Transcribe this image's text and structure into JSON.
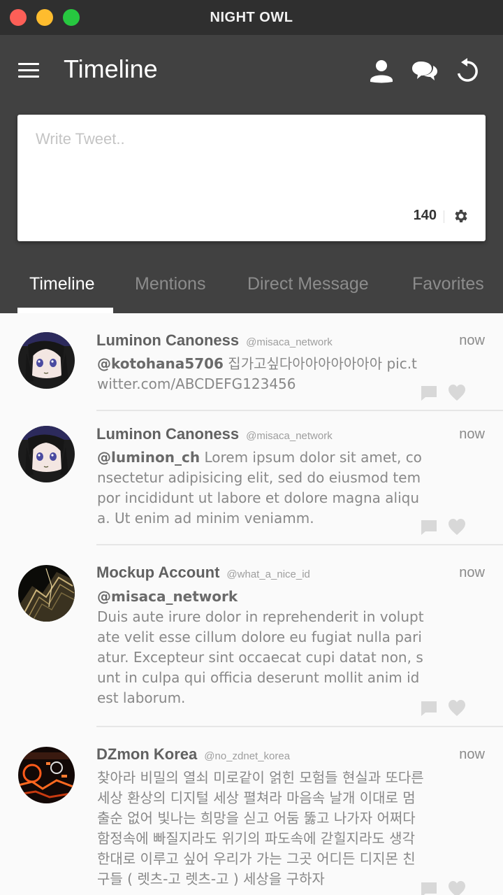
{
  "window": {
    "title": "NIGHT OWL"
  },
  "header": {
    "title": "Timeline"
  },
  "composer": {
    "placeholder": "Write Tweet..",
    "char_count": "140"
  },
  "tabs": [
    {
      "label": "Timeline",
      "active": true
    },
    {
      "label": "Mentions",
      "active": false
    },
    {
      "label": "Direct Message",
      "active": false
    },
    {
      "label": "Favorites",
      "active": false
    }
  ],
  "icons": {
    "menu": "menu-icon",
    "profile": "person-icon",
    "chat": "chat-bubbles-icon",
    "refresh": "refresh-icon",
    "settings": "gear-icon",
    "reply": "comment-icon",
    "favorite": "heart-icon"
  },
  "colors": {
    "title_bar": "#2f2f2f",
    "app_bar": "#414141",
    "feed_bg": "#fafafa",
    "text_muted": "#888888"
  },
  "tweets": [
    {
      "name": "Luminon Canoness",
      "handle": "@misaca_network",
      "time": "now",
      "mention": "@kotohana5706",
      "text": " 집가고싶다아아아아아아아 pic.twitter.com/ABCDEFG123456"
    },
    {
      "name": "Luminon Canoness",
      "handle": "@misaca_network",
      "time": "now",
      "mention": "@luminon_ch",
      "text": " Lorem ipsum dolor sit amet, consectetur adipisicing elit, sed do eiusmod tempor incididunt ut labore et dolore magna aliqua. Ut enim ad minim veniamm."
    },
    {
      "name": "Mockup Account",
      "handle": "@what_a_nice_id",
      "time": "now",
      "mention": "@misaca_network",
      "text": "Duis aute irure dolor in reprehenderit in voluptate velit esse cillum dolore eu fugiat nulla pariatur. Excepteur sint occaecat cupi datat non, sunt in culpa qui officia deserunt mollit anim id est laborum."
    },
    {
      "name": "DZmon Korea",
      "handle": "@no_zdnet_korea",
      "time": "now",
      "mention": "",
      "text": "찾아라 비밀의 열쇠 미로같이 얽힌 모험들 현실과 또다른 세상 환상의 디지털 세상 펼쳐라 마음속 날개 이대로 멈출순 없어 빛나는 희망을 싣고 어둠 뚫고 나가자 어쩌다 함정속에 빠질지라도 위기의 파도속에 갇힐지라도 생각한대로 이루고 싶어 우리가 가는 그곳 어디든 디지몬 친구들 ( 렛츠-고 렛츠-고 ) 세상을 구하자"
    }
  ]
}
